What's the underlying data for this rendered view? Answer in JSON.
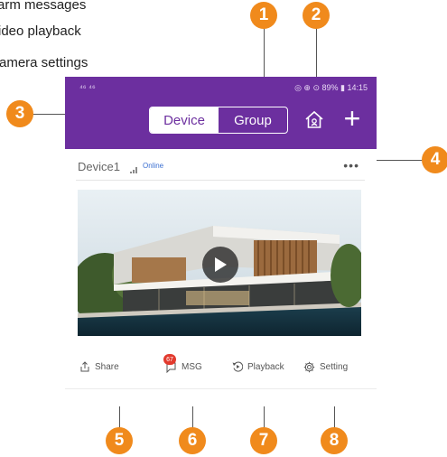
{
  "legend": {
    "line1": "arm messages",
    "line2": "ideo playback",
    "line3": "amera settings"
  },
  "callouts": [
    "1",
    "2",
    "3",
    "4",
    "5",
    "6",
    "7",
    "8"
  ],
  "status_bar": {
    "left": "⁴⁶ ⁴⁶",
    "right": "◎ ⊕ ⊙ 89% ▮ 14:15"
  },
  "header": {
    "tabs": [
      {
        "label": "Device",
        "active": true
      },
      {
        "label": "Group",
        "active": false
      }
    ],
    "home_icon": "home-icon",
    "add_label": "+"
  },
  "device": {
    "name": "Device1",
    "status": "Online",
    "more_label": "•••"
  },
  "video": {
    "preview": "house-preview",
    "play_icon": "play-icon"
  },
  "actions": {
    "share": "Share",
    "msg": "MSG",
    "msg_count": "67",
    "playback": "Playback",
    "setting": "Setting"
  },
  "colors": {
    "header_bg": "#6c2f9f",
    "callout": "#f08a1c",
    "online": "#3b6fd1",
    "badge": "#e23a2e"
  }
}
